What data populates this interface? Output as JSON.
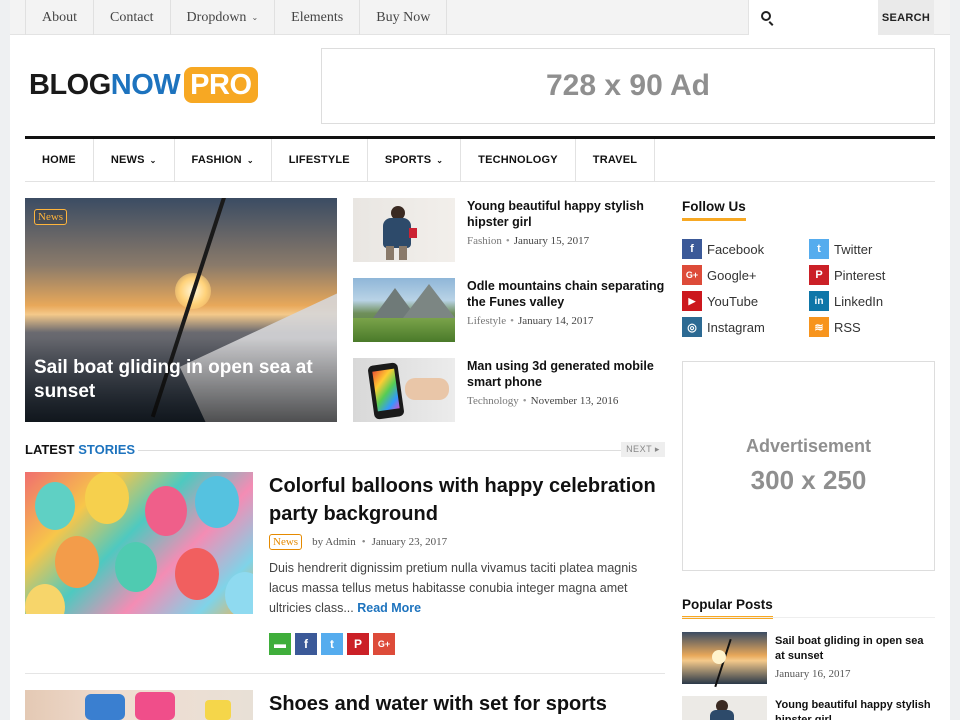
{
  "topnav": {
    "items": [
      "About",
      "Contact",
      "Dropdown",
      "Elements",
      "Buy Now"
    ],
    "search_placeholder": "",
    "search_button": "SEARCH"
  },
  "logo": {
    "part1": "BLOG",
    "part2": "NOW",
    "part3": "PRO"
  },
  "ad_top": "728 x 90 Ad",
  "mainnav": {
    "items": [
      "HOME",
      "NEWS",
      "FASHION",
      "LIFESTYLE",
      "SPORTS",
      "TECHNOLOGY",
      "TRAVEL"
    ],
    "has_dropdown": [
      false,
      true,
      true,
      false,
      true,
      false,
      false
    ]
  },
  "featured": {
    "category": "News",
    "title": "Sail boat gliding in open sea at sunset"
  },
  "side_posts": [
    {
      "title": "Young beautiful happy stylish hipster girl",
      "category": "Fashion",
      "date": "January 15, 2017"
    },
    {
      "title": "Odle mountains chain separating the Funes valley",
      "category": "Lifestyle",
      "date": "January 14, 2017"
    },
    {
      "title": "Man using 3d generated mobile smart phone",
      "category": "Technology",
      "date": "November 13, 2016"
    }
  ],
  "latest": {
    "label1": "LATEST",
    "label2": "STORIES",
    "next": "NEXT ▸"
  },
  "posts": [
    {
      "title": "Colorful balloons with happy celebration party background",
      "category": "News",
      "author": "by Admin",
      "date": "January 23, 2017",
      "excerpt": "Duis hendrerit dignissim pretium nulla vivamus taciti platea magnis lacus massa tellus metus habitasse conubia integer magna amet ultricies class... ",
      "read_more": "Read More"
    },
    {
      "title": "Shoes and water with set for sports"
    }
  ],
  "share_icons": [
    {
      "name": "comment",
      "glyph": "▬",
      "color": "#3fae3b"
    },
    {
      "name": "facebook",
      "glyph": "f",
      "color": "#3b5998"
    },
    {
      "name": "twitter",
      "glyph": "t",
      "color": "#55acee"
    },
    {
      "name": "pinterest",
      "glyph": "P",
      "color": "#cb2027"
    },
    {
      "name": "google-plus",
      "glyph": "G+",
      "color": "#dd4b39"
    }
  ],
  "follow": {
    "title": "Follow Us",
    "items": [
      {
        "label": "Facebook",
        "glyph": "f",
        "color": "#3b5998"
      },
      {
        "label": "Twitter",
        "glyph": "t",
        "color": "#55acee"
      },
      {
        "label": "Google+",
        "glyph": "G+",
        "color": "#dd4b39"
      },
      {
        "label": "Pinterest",
        "glyph": "P",
        "color": "#cb2027"
      },
      {
        "label": "YouTube",
        "glyph": "▶",
        "color": "#cc181e"
      },
      {
        "label": "LinkedIn",
        "glyph": "in",
        "color": "#0e76a8"
      },
      {
        "label": "Instagram",
        "glyph": "◎",
        "color": "#2c6a93"
      },
      {
        "label": "RSS",
        "glyph": "≋",
        "color": "#f7941d"
      }
    ]
  },
  "ad_side": {
    "line1": "Advertisement",
    "line2": "300 x 250"
  },
  "popular": {
    "title": "Popular Posts",
    "items": [
      {
        "title": "Sail boat gliding in open sea at sunset",
        "date": "January 16, 2017"
      },
      {
        "title": "Young beautiful happy stylish hipster girl",
        "date": ""
      }
    ]
  },
  "colors": {
    "accent": "#f7a823",
    "blue": "#1d73be"
  }
}
